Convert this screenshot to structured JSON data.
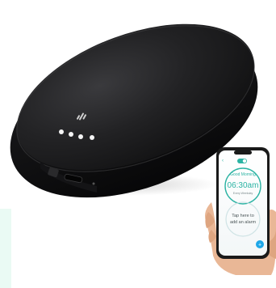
{
  "colors": {
    "device_body": "#1f1f21",
    "device_shadow": "#0b0b0c",
    "led": "#f4f4f4",
    "accent": "#2bb3a3",
    "blue_button": "#1ea7e8",
    "mint_panel": "#eafaf4",
    "skin": "#e9b796"
  },
  "device": {
    "led_count": 4
  },
  "phone": {
    "greeting": "Good Morning",
    "time": "06:30am",
    "subtitle": "Every Weekday",
    "prompt_line1": "Tap here to",
    "prompt_line2": "add an alarm"
  },
  "icons": {
    "logo": "mic-wave-logo-icon",
    "add": "plus-icon"
  }
}
